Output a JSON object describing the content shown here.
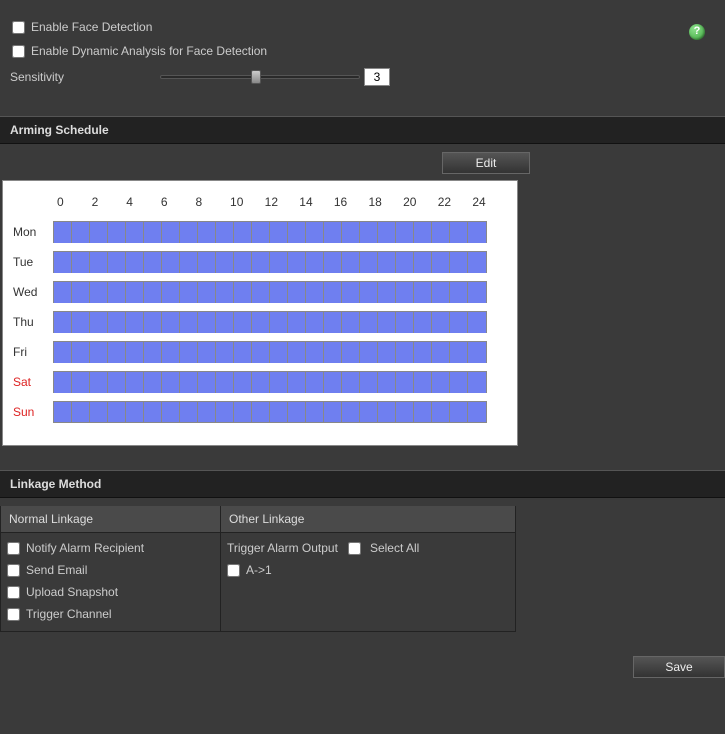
{
  "options": {
    "enable_face_label": "Enable Face Detection",
    "enable_dynamic_label": "Enable Dynamic Analysis for Face Detection",
    "sensitivity_label": "Sensitivity",
    "sensitivity_value": "3",
    "sensitivity_fraction": 0.48
  },
  "arming": {
    "header": "Arming Schedule",
    "edit_label": "Edit",
    "hours": [
      "0",
      "2",
      "4",
      "6",
      "8",
      "10",
      "12",
      "14",
      "16",
      "18",
      "20",
      "22",
      "24"
    ],
    "days": [
      {
        "label": "Mon",
        "weekend": false
      },
      {
        "label": "Tue",
        "weekend": false
      },
      {
        "label": "Wed",
        "weekend": false
      },
      {
        "label": "Thu",
        "weekend": false
      },
      {
        "label": "Fri",
        "weekend": false
      },
      {
        "label": "Sat",
        "weekend": true
      },
      {
        "label": "Sun",
        "weekend": true
      }
    ]
  },
  "linkage": {
    "header": "Linkage Method",
    "normal_header": "Normal Linkage",
    "other_header": "Other Linkage",
    "normal_items": [
      "Notify Alarm Recipient",
      "Send Email",
      "Upload Snapshot",
      "Trigger Channel"
    ],
    "trigger_output_label": "Trigger Alarm Output",
    "select_all_label": "Select All",
    "outputs": [
      "A->1"
    ]
  },
  "save_label": "Save"
}
